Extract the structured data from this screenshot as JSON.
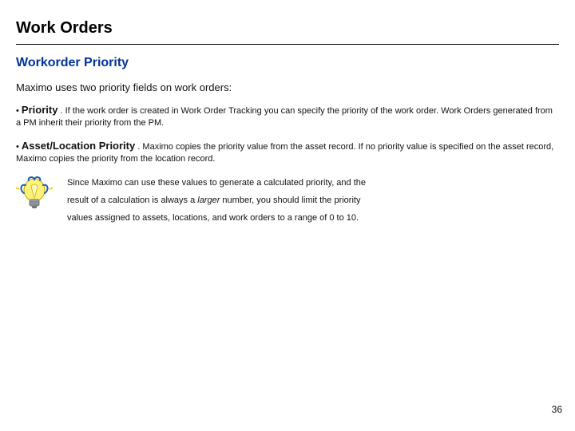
{
  "title": "Work Orders",
  "section_title": "Workorder Priority",
  "lead": "Maximo uses two priority fields on work orders:",
  "bullets": {
    "priority": {
      "label": "Priority",
      "text": ". If the work order is created in Work Order Tracking you can specify the priority of the work order. Work Orders generated from a PM inherit their priority from the PM."
    },
    "asset_location": {
      "label": "Asset/Location Priority",
      "text": ". Maximo copies the priority value from the asset record. If no priority value is specified on the asset record, Maximo copies the priority from the location record."
    }
  },
  "tip": {
    "line1": "Since Maximo can use these values to generate a calculated priority, and the",
    "line2a": "result of a calculation is always a ",
    "line2_italic": "larger",
    "line2b": " number, you should limit the priority",
    "line3": "values assigned to assets, locations, and work orders to a range of 0 to 10."
  },
  "page_number": "36"
}
